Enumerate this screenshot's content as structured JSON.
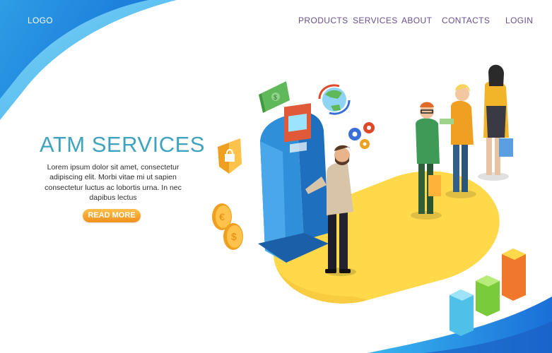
{
  "header": {
    "logo": "LOGO",
    "nav": [
      {
        "label": "PRODUCTS"
      },
      {
        "label": "SERVICES"
      },
      {
        "label": "ABOUT"
      },
      {
        "label": "CONTACTS"
      },
      {
        "label": "LOGIN"
      }
    ]
  },
  "hero": {
    "title": "ATM SERVICES",
    "description": "Lorem ipsum dolor sit amet, consectetur adipiscing elit. Morbi vitae mi ut sapien consectetur luctus ac lobortis urna. In nec dapibus lectus",
    "cta_label": "READ MORE"
  },
  "colors": {
    "primary_blue": "#1f8fe0",
    "title_teal": "#3fa3bf",
    "nav_purple": "#6b4f8e",
    "cta_orange": "#f2901b",
    "accent_yellow": "#ffd94a"
  },
  "illustration": {
    "items": [
      "atm-machine",
      "man-at-atm",
      "queue-people",
      "money-icon",
      "globe-icon",
      "gears-icon",
      "shield-lock-icon",
      "euro-coin-icon",
      "dollar-coin-icon",
      "bar-chart-icon"
    ]
  }
}
